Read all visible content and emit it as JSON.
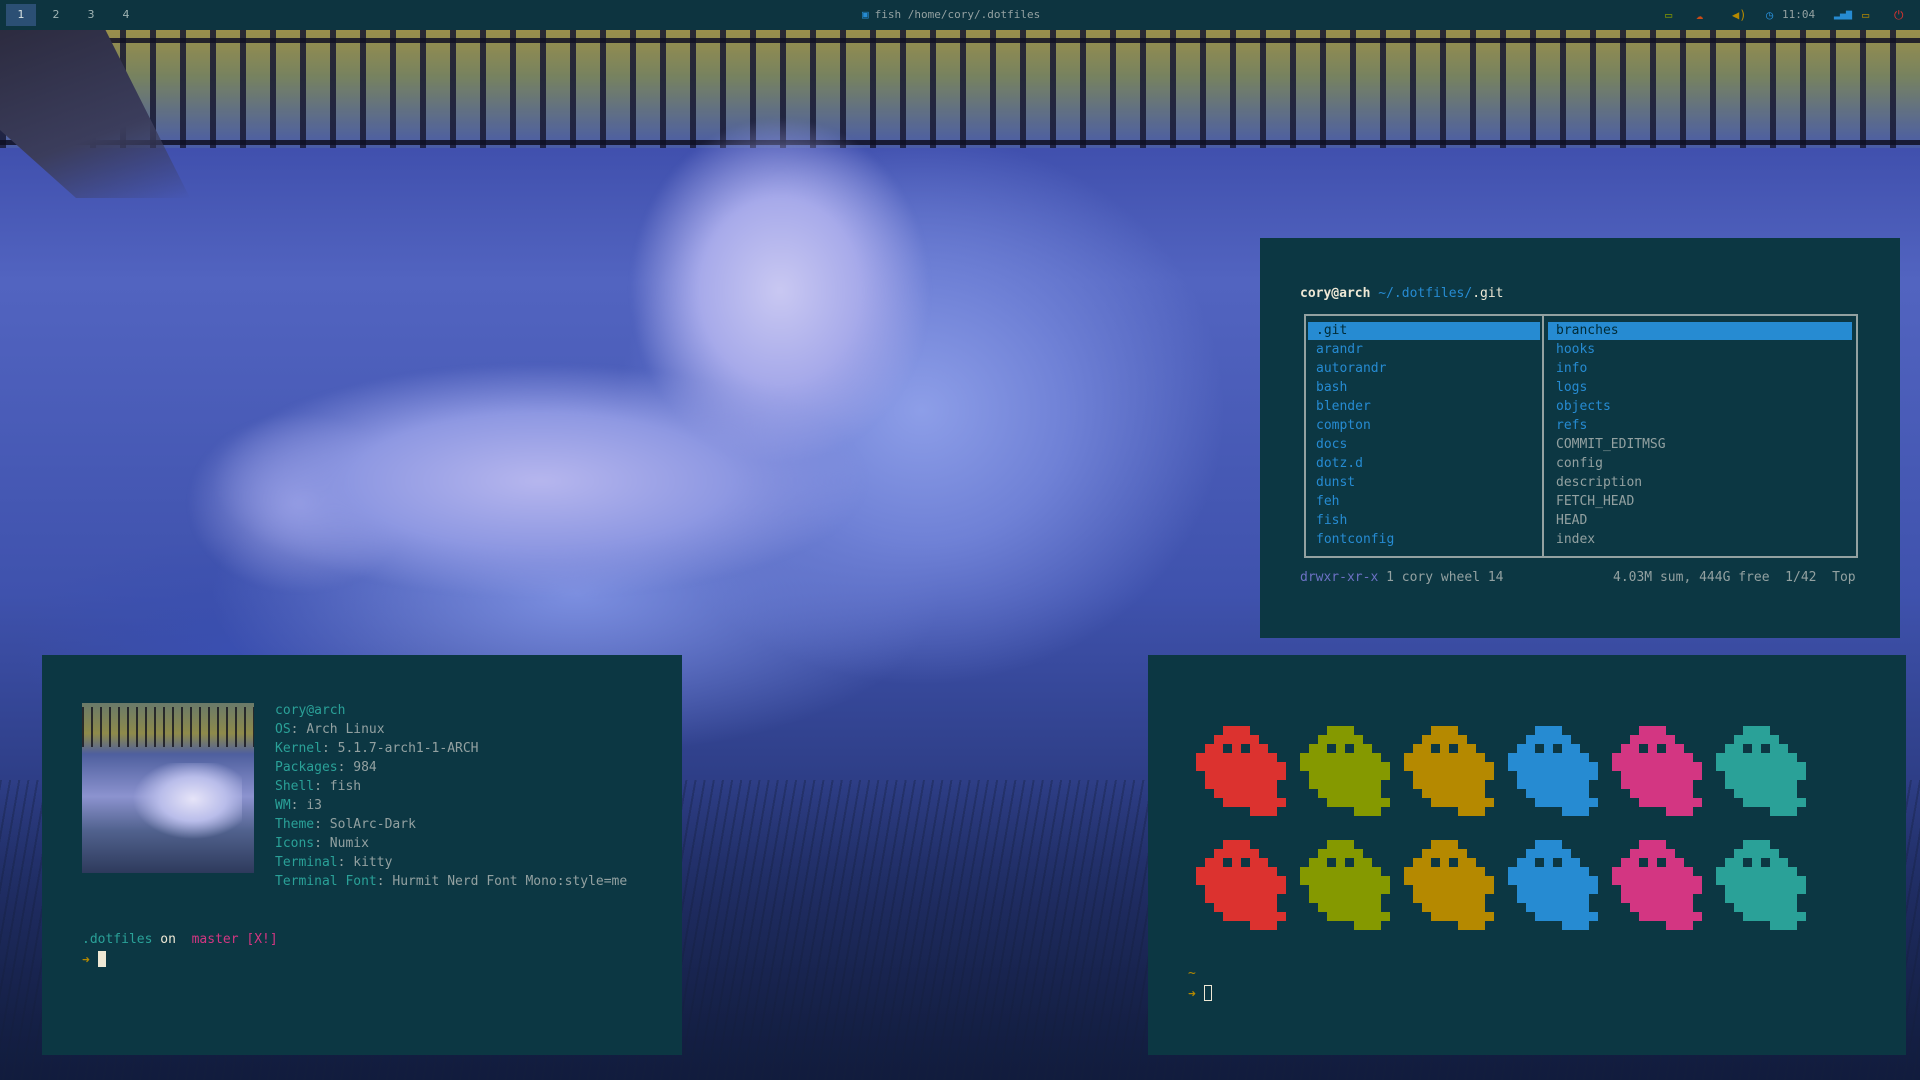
{
  "topbar": {
    "workspaces": [
      "1",
      "2",
      "3",
      "4"
    ],
    "active_workspace": "1",
    "window_title": "fish /home/cory/.dotfiles",
    "title_icon": "terminal-icon",
    "clock": "11:04",
    "tray_icons": [
      "battery-icon",
      "cloud-upload-icon",
      "volume-icon",
      "clock-icon",
      "signal-bars-icon",
      "monitor-icon",
      "power-icon"
    ],
    "colors": {
      "bar_bg": "#0d3440",
      "active_ws": "#2b4f74"
    }
  },
  "ranger": {
    "user_host": "cory@arch",
    "path_prefix": "~/.dotfiles/",
    "path_current": ".git",
    "left_items": [
      ".git",
      "arandr",
      "autorandr",
      "bash",
      "blender",
      "compton",
      "docs",
      "dotz.d",
      "dunst",
      "feh",
      "fish",
      "fontconfig"
    ],
    "right_dirs": [
      "branches",
      "hooks",
      "info",
      "logs",
      "objects",
      "refs"
    ],
    "right_files": [
      "COMMIT_EDITMSG",
      "config",
      "description",
      "FETCH_HEAD",
      "HEAD",
      "index"
    ],
    "status_perms": "drwxr-xr-x",
    "status_info": "1 cory wheel 14",
    "status_right": "4.03M sum, 444G free  1/42  Top"
  },
  "neofetch": {
    "title": "cory@arch",
    "fields": [
      {
        "key": "OS",
        "value": "Arch Linux"
      },
      {
        "key": "Kernel",
        "value": "5.1.7-arch1-1-ARCH"
      },
      {
        "key": "Packages",
        "value": "984"
      },
      {
        "key": "Shell",
        "value": "fish"
      },
      {
        "key": "WM",
        "value": "i3"
      },
      {
        "key": "Theme",
        "value": "SolArc-Dark"
      },
      {
        "key": "Icons",
        "value": "Numix"
      },
      {
        "key": "Terminal",
        "value": "kitty"
      },
      {
        "key": "Terminal Font",
        "value": "Hurmit Nerd Font Mono:style=me"
      }
    ],
    "prompt_dir": ".dotfiles",
    "prompt_on": "on",
    "prompt_branch_icon": "",
    "prompt_branch": "master",
    "prompt_status": "[X!]",
    "prompt_arrow": "➜"
  },
  "ghosts": {
    "colors": [
      "#dc322f",
      "#859900",
      "#b58900",
      "#268bd2",
      "#d33682",
      "#2aa198"
    ],
    "rows": 2,
    "prompt_tilde": "~",
    "prompt_arrow": "➜"
  }
}
